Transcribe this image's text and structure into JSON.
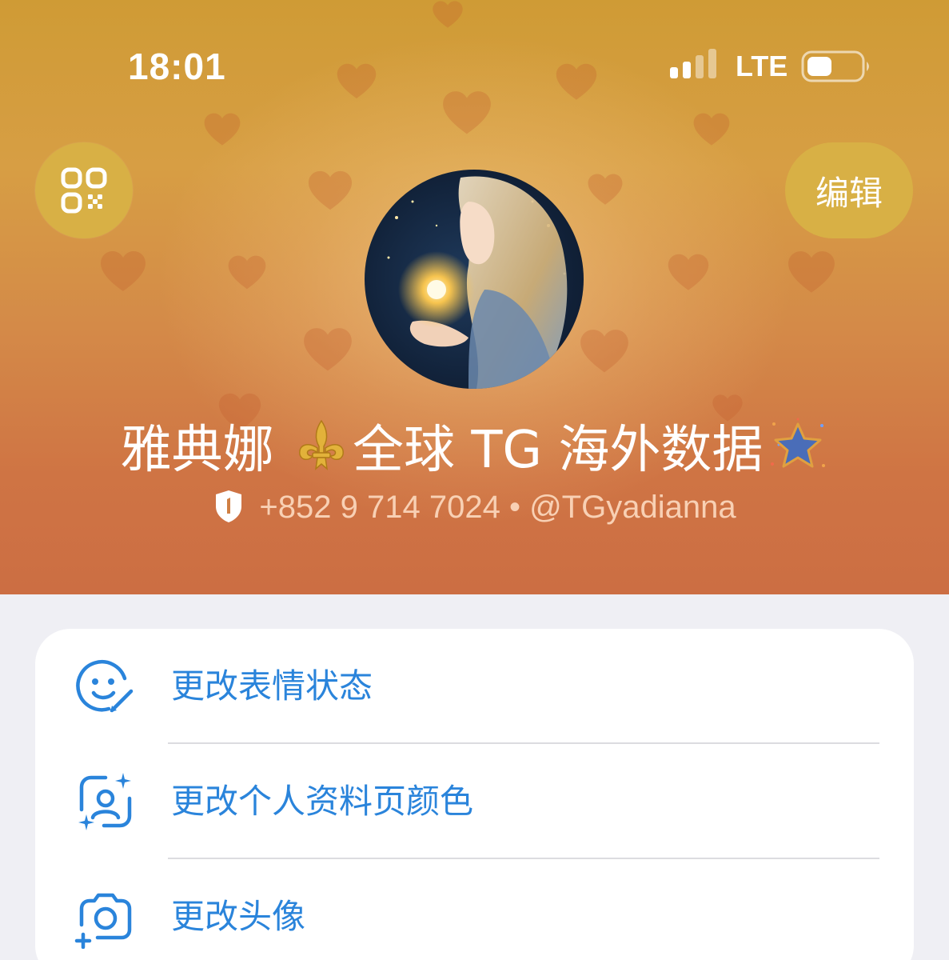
{
  "status_bar": {
    "time": "18:01",
    "network": "LTE"
  },
  "header": {
    "edit_label": "编辑",
    "name_part1": "雅典娜 ",
    "name_part2": "全球 TG 海外数据",
    "phone": "+852 9 714 7024",
    "separator": " • ",
    "username": "@TGyadianna",
    "colors": {
      "gradient_top": "#cf9b35",
      "gradient_bottom": "#cc6e43",
      "button_bg": "#d8b045"
    }
  },
  "menu": {
    "items": [
      {
        "label": "更改表情状态",
        "icon": "emoji-status-icon"
      },
      {
        "label": "更改个人资料页颜色",
        "icon": "profile-color-icon"
      },
      {
        "label": "更改头像",
        "icon": "add-photo-icon"
      }
    ],
    "accent_color": "#2a84db"
  }
}
